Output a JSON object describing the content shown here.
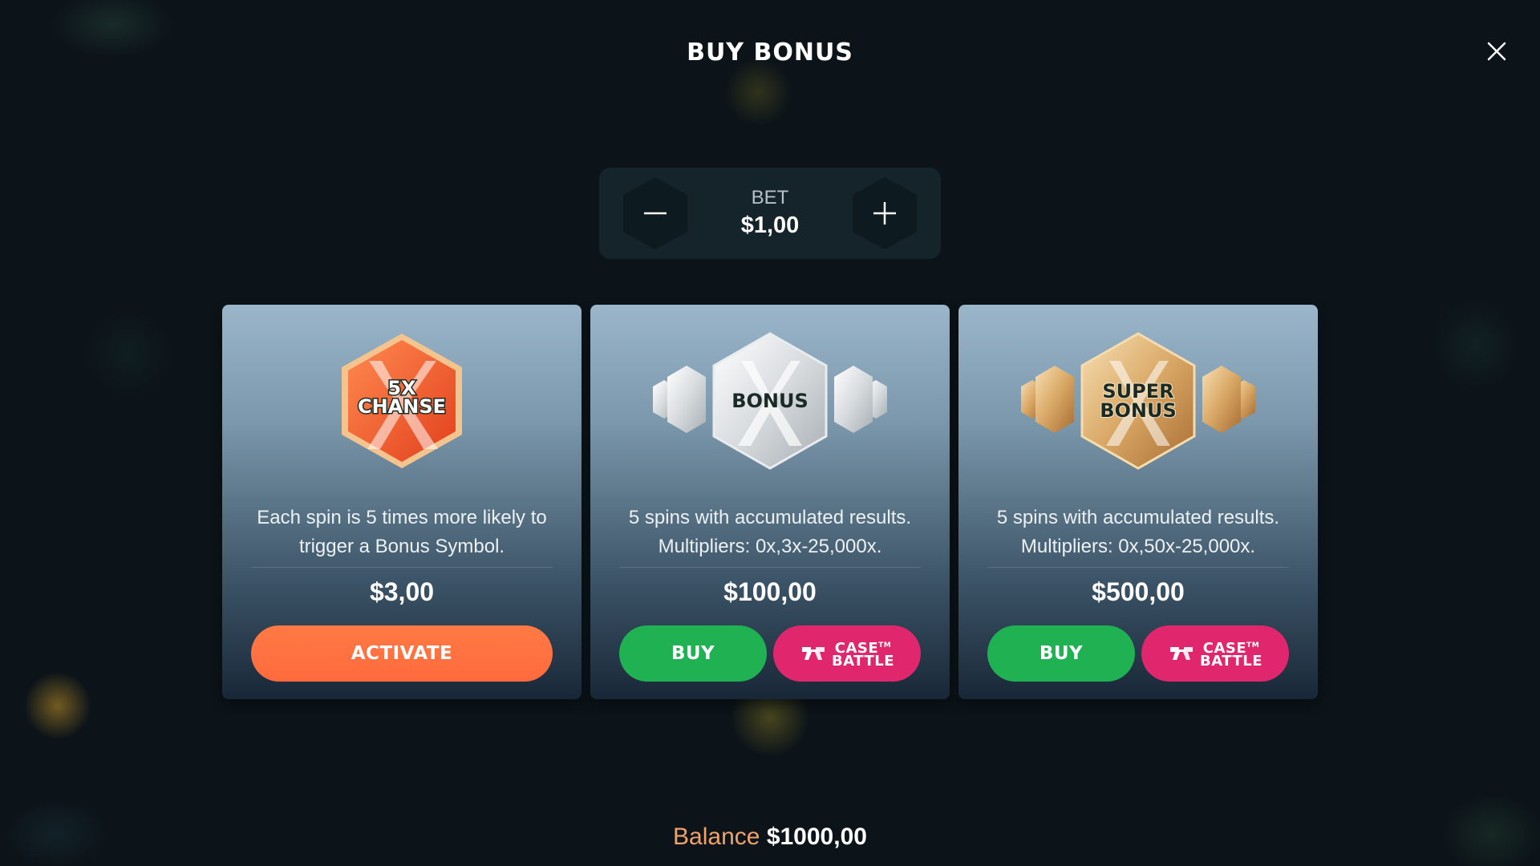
{
  "header": {
    "title": "BUY BONUS",
    "close_icon": "close-icon"
  },
  "bet": {
    "label": "BET",
    "value": "$1,00",
    "decrease_icon": "minus-icon",
    "increase_icon": "plus-icon"
  },
  "cards": [
    {
      "badge_lines": [
        "5X",
        "CHANSE"
      ],
      "description": "Each spin is 5 times more likely to trigger a Bonus Symbol.",
      "price": "$3,00",
      "primary_label": "ACTIVATE"
    },
    {
      "badge_text": "BONUS",
      "description": "5 spins with accumulated results. Multipliers: 0x,3x-25,000x.",
      "price": "$100,00",
      "primary_label": "BUY",
      "case_battle_lines": [
        "CASE",
        "BATTLE"
      ],
      "case_battle_tm": "TM"
    },
    {
      "badge_lines": [
        "SUPER",
        "BONUS"
      ],
      "description": "5 spins with accumulated results. Multipliers: 0x,50x-25,000x.",
      "price": "$500,00",
      "primary_label": "BUY",
      "case_battle_lines": [
        "CASE",
        "BATTLE"
      ],
      "case_battle_tm": "TM"
    }
  ],
  "balance": {
    "label": "Balance",
    "value": "$1000,00"
  },
  "colors": {
    "background": "#0c1419",
    "activate": "#ff6a3d",
    "buy": "#1fb152",
    "case_battle": "#e0266d",
    "balance_label": "#f0a26a"
  }
}
